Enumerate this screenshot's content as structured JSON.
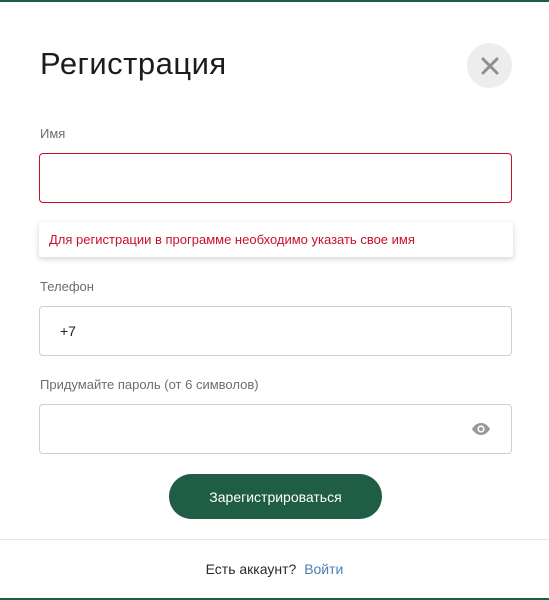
{
  "modal": {
    "title": "Регистрация",
    "close_icon": "close-icon"
  },
  "form": {
    "name": {
      "label": "Имя",
      "value": "",
      "error": "Для регистрации в программе необходимо указать свое имя"
    },
    "phone": {
      "label": "Телефон",
      "value": "+7"
    },
    "password": {
      "label": "Придумайте пароль (от 6 символов)",
      "value": "",
      "toggle_icon": "eye-icon"
    },
    "submit_label": "Зарегистрироваться"
  },
  "footer": {
    "text": "Есть аккаунт?",
    "link_label": "Войти"
  },
  "colors": {
    "accent": "#1f5d44",
    "error": "#c8102e",
    "link": "#4d7fb3"
  }
}
